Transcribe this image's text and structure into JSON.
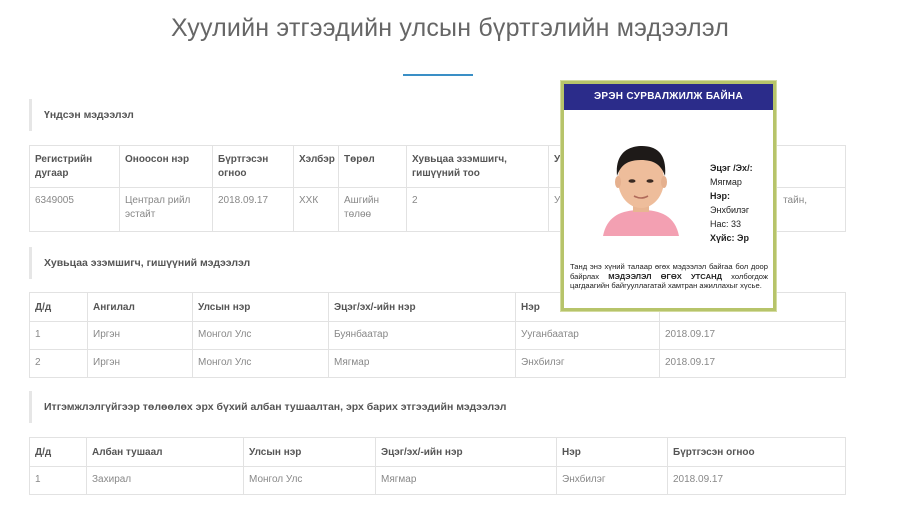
{
  "title": "Хуулийн этгээдийн улсын бүртгэлийн мэдээлэл",
  "colors": {
    "accent": "#3a8fc6",
    "badge_header": "#2b2c8a",
    "badge_border": "#b7c46a"
  },
  "basic": {
    "label": "Үндсэн мэдээлэл",
    "headers": [
      "Регистрийн дугаар",
      "Оноосон нэр",
      "Бүртгэсэн огноо",
      "Хэлбэр",
      "Төрөл",
      "Хувьцаа эзэмшигч, гишүүний тоо",
      "У"
    ],
    "row": [
      "6349005",
      "Централ рийл эстайт",
      "2018.09.17",
      "ХХК",
      "Ашгийн төлөө",
      "2",
      "У"
    ],
    "trailing": "тайн,"
  },
  "shareholders": {
    "label": "Хувьцаа эзэмшигч, гишүүний мэдээлэл",
    "headers": [
      "Д/д",
      "Ангилал",
      "Улсын нэр",
      "Эцэг/эх/-ийн нэр",
      "Нэр",
      ""
    ],
    "rows": [
      [
        "1",
        "Иргэн",
        "Монгол Улс",
        "Буянбаатар",
        "Ууганбаатар",
        "2018.09.17"
      ],
      [
        "2",
        "Иргэн",
        "Монгол Улс",
        "Мягмар",
        "Энхбилэг",
        "2018.09.17"
      ]
    ]
  },
  "officials": {
    "label": "Итгэмжлэлгүйгээр төлөөлөх эрх бүхий албан тушаалтан, эрх барих этгээдийн мэдээлэл",
    "headers": [
      "Д/д",
      "Албан тушаал",
      "Улсын нэр",
      "Эцэг/эх/-ийн нэр",
      "Нэр",
      "Бүртгэсэн огноо"
    ],
    "rows": [
      [
        "1",
        "Захирал",
        "Монгол Улс",
        "Мягмар",
        "Энхбилэг",
        "2018.09.17"
      ]
    ]
  },
  "badge": {
    "header": "ЭРЭН СУРВАЛЖИЛЖ БАЙНА",
    "father_label": "Эцэг /Эх/:",
    "father_value": "Мягмар",
    "name_label": "Нэр:",
    "name_value": "Энхбилэг",
    "age": "Нас: 33",
    "gender": "Хүйс: Эр",
    "note_part1": "Танд энэ хүний талаар өгөх мэдээлэл байгаа бол доор байрлах ",
    "note_bold": "МЭДЭЭЛЭЛ ӨГӨХ УТСАНД",
    "note_part2": " холбогдож цагдаагийн байгууллагатай хамтран ажиллахыг хүсье."
  }
}
